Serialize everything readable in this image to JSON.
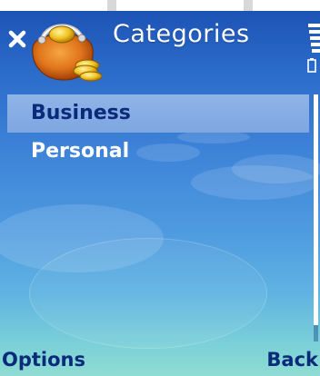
{
  "header": {
    "title": "Categories",
    "app_icon": "wallet-icon",
    "close_icon": "close-icon",
    "signal_icon": "signal-strength-icon",
    "battery_icon": "battery-icon"
  },
  "list": {
    "items": [
      {
        "label": "Business",
        "selected": true
      },
      {
        "label": "Personal",
        "selected": false
      }
    ]
  },
  "softkeys": {
    "left": "Options",
    "right": "Back"
  },
  "colors": {
    "background_top": "#1a4fb0",
    "background_bottom": "#8fdcd2",
    "selection": "#8fb4e8",
    "softkey_text": "#0a2a7a"
  }
}
